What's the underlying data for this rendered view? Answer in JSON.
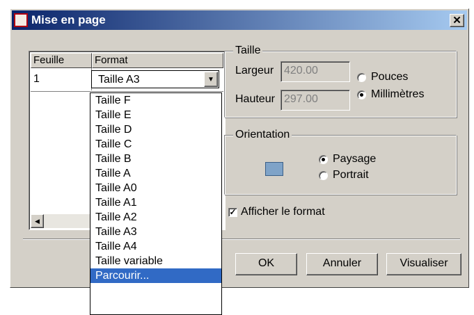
{
  "window": {
    "title": "Mise en page",
    "close_glyph": "✕"
  },
  "sheet_grid": {
    "col_sheet": "Feuille",
    "col_format": "Format",
    "row_sheet": "1",
    "row_format": "Taille A3"
  },
  "format_dropdown": {
    "options": [
      "Taille F",
      "Taille E",
      "Taille D",
      "Taille C",
      "Taille B",
      "Taille A",
      "Taille A0",
      "Taille A1",
      "Taille A2",
      "Taille A3",
      "Taille A4",
      "Taille variable",
      "Parcourir..."
    ],
    "highlighted": "Parcourir..."
  },
  "size_group": {
    "label": "Taille",
    "width_label": "Largeur",
    "width_value": "420.00",
    "height_label": "Hauteur",
    "height_value": "297.00",
    "unit_inches": "Pouces",
    "unit_mm": "Millimètres",
    "selected_unit": "Millimètres"
  },
  "orientation_group": {
    "label": "Orientation",
    "landscape": "Paysage",
    "portrait": "Portrait",
    "selected": "Paysage"
  },
  "show_format": {
    "label": "Afficher le format",
    "checked": true
  },
  "buttons": {
    "ok": "OK",
    "cancel": "Annuler",
    "preview": "Visualiser"
  },
  "colors": {
    "title_start": "#0a246a",
    "title_end": "#a6caf0",
    "selection": "#316ac5",
    "face": "#d4d0c8"
  }
}
